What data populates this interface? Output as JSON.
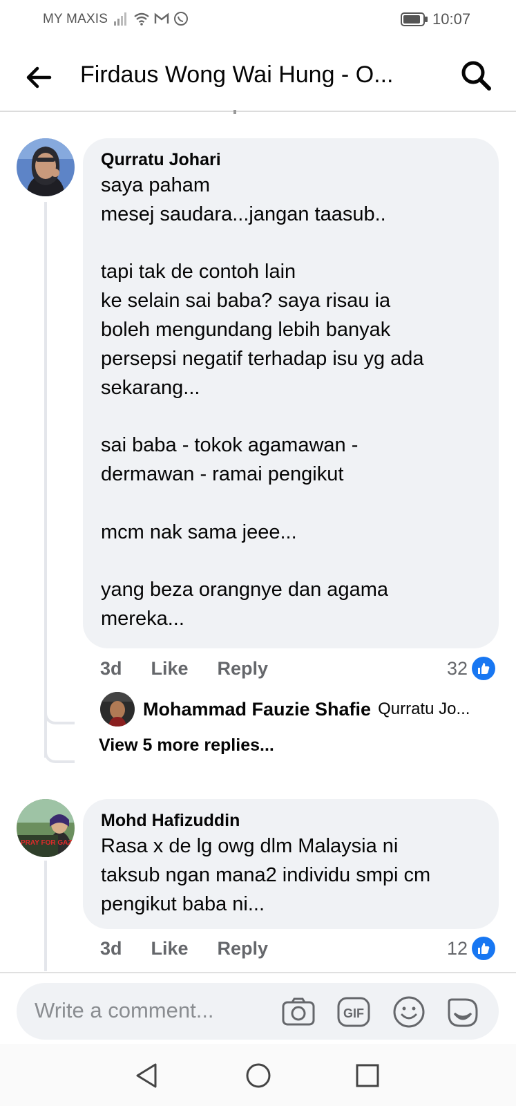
{
  "status_bar": {
    "carrier": "MY MAXIS",
    "time": "10:07",
    "icons": [
      "signal-icon",
      "wifi-icon",
      "gmail-icon",
      "whatsapp-icon",
      "battery-icon"
    ]
  },
  "header": {
    "title": "Firdaus Wong Wai Hung - O...",
    "back_icon": "back-arrow-icon",
    "search_icon": "search-icon"
  },
  "comments": [
    {
      "author": "Qurratu Johari",
      "text": "saya paham\nmesej saudara...jangan taasub..\n\ntapi tak de contoh lain\nke selain sai baba? saya risau ia\nboleh mengundang lebih banyak\npersepsi negatif terhadap isu yg ada\nsekarang...\n\nsai baba - tokok agamawan -\ndermawan - ramai pengikut\n\nmcm nak sama jeee...\n\nyang beza orangnye dan agama\nmereka...",
      "time": "3d",
      "like_label": "Like",
      "reply_label": "Reply",
      "reaction_count": "32",
      "reply_preview": {
        "author": "Mohammad Fauzie Shafie",
        "snippet": "Qurratu Jo..."
      },
      "view_more": "View 5 more replies..."
    },
    {
      "author": "Mohd Hafizuddin",
      "text": "Rasa x de lg owg dlm Malaysia ni\ntaksub ngan mana2 individu smpi cm\npengikut baba ni...",
      "time": "3d",
      "like_label": "Like",
      "reply_label": "Reply",
      "reaction_count": "12",
      "avatar_text": "PRAY FOR GAZA"
    }
  ],
  "composer": {
    "placeholder": "Write a comment...",
    "icons": [
      "camera-icon",
      "gif-icon",
      "emoji-icon",
      "sticker-icon"
    ],
    "gif_label": "GIF"
  },
  "nav": {
    "icons": [
      "nav-back-icon",
      "nav-home-icon",
      "nav-recents-icon"
    ]
  },
  "colors": {
    "bubble": "#f0f2f5",
    "muted": "#65676b",
    "like_blue": "#1877f2",
    "thread_line": "#e4e6eb"
  }
}
